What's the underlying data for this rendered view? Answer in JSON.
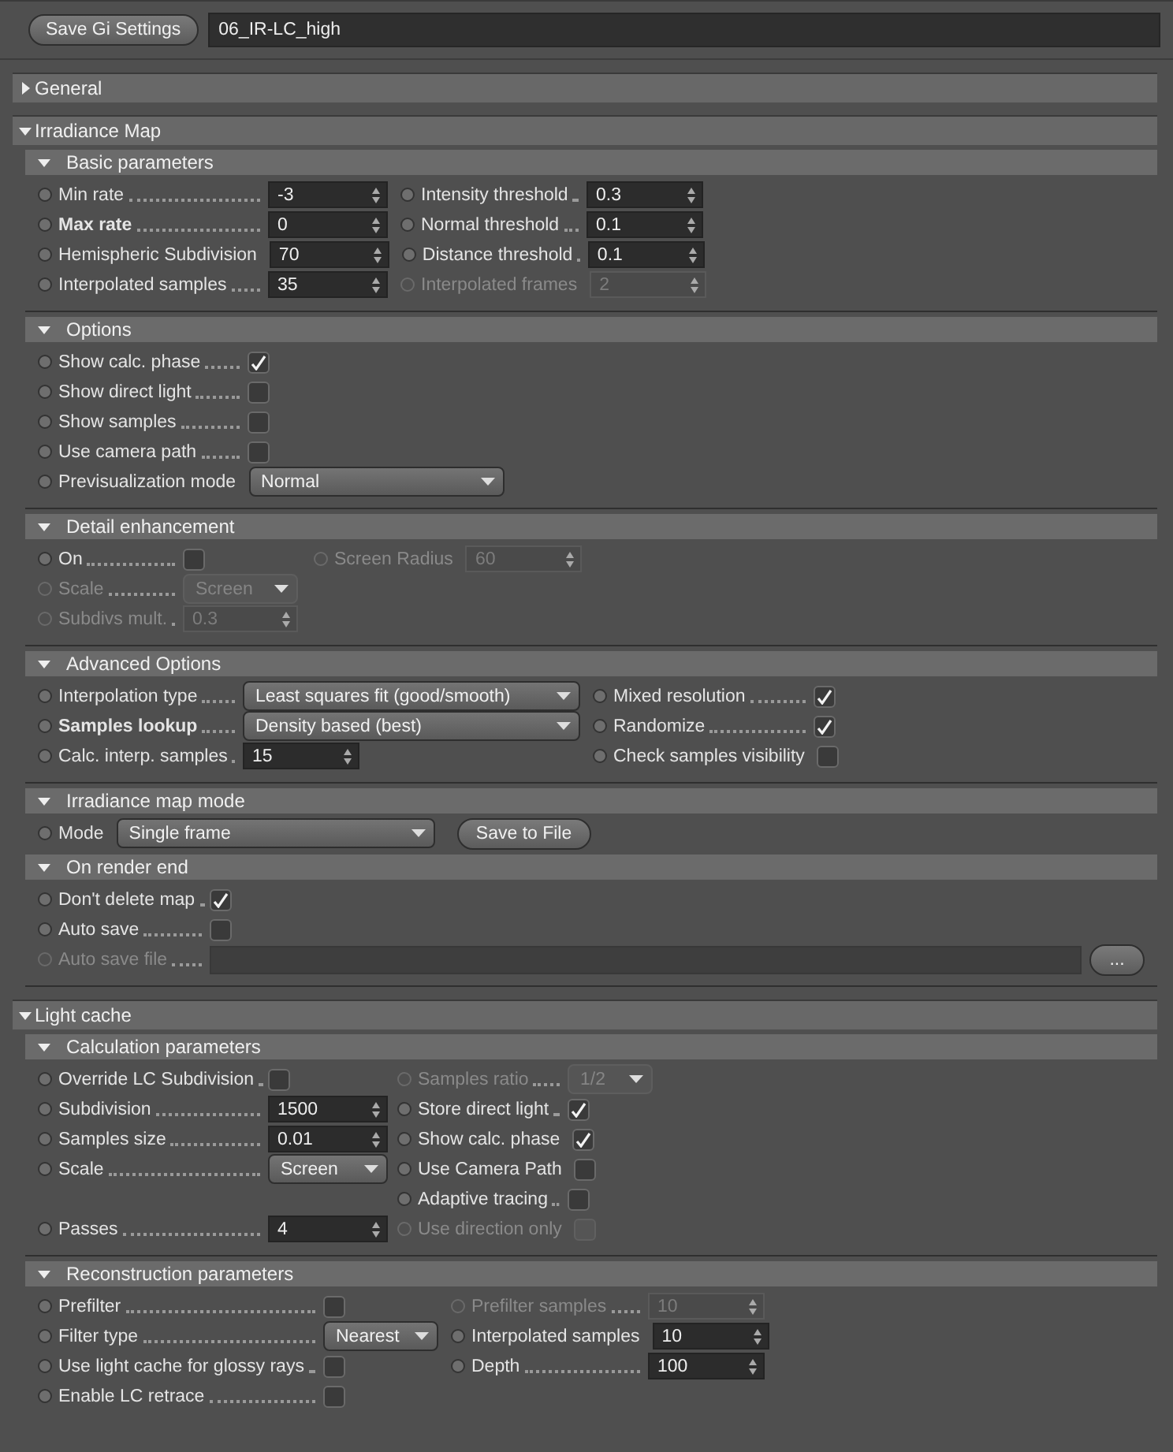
{
  "toolbar": {
    "button": "Save Gi Settings",
    "preset": "06_IR-LC_high"
  },
  "groups": [
    {
      "title": "General",
      "expanded": false
    },
    {
      "title": "Irradiance Map",
      "expanded": true,
      "sections": [
        {
          "title": "Basic parameters",
          "expanded": true,
          "rows": [
            [
              {
                "kind": "number",
                "label": "Min rate",
                "value": "-3",
                "disabled": false,
                "bold": false
              },
              {
                "kind": "number",
                "label": "Intensity threshold",
                "value": "0.3",
                "disabled": false,
                "bold": false
              }
            ],
            [
              {
                "kind": "number",
                "label": "Max rate",
                "value": "0",
                "disabled": false,
                "bold": true
              },
              {
                "kind": "number",
                "label": "Normal threshold",
                "value": "0.1",
                "disabled": false,
                "bold": false
              }
            ],
            [
              {
                "kind": "number",
                "label": "Hemispheric Subdivision",
                "value": "70",
                "disabled": false,
                "bold": false
              },
              {
                "kind": "number",
                "label": "Distance threshold",
                "value": "0.1",
                "disabled": false,
                "bold": false
              }
            ],
            [
              {
                "kind": "number",
                "label": "Interpolated samples",
                "value": "35",
                "disabled": false,
                "bold": false
              },
              {
                "kind": "number",
                "label": "Interpolated frames",
                "value": "2",
                "disabled": true,
                "bold": false
              }
            ]
          ]
        },
        {
          "title": "Options",
          "expanded": true,
          "rows": [
            [
              {
                "kind": "check",
                "label": "Show calc. phase",
                "checked": true,
                "disabled": false,
                "bold": false
              }
            ],
            [
              {
                "kind": "check",
                "label": "Show direct light",
                "checked": false,
                "disabled": false,
                "bold": false
              }
            ],
            [
              {
                "kind": "check",
                "label": "Show samples",
                "checked": false,
                "disabled": false,
                "bold": false
              }
            ],
            [
              {
                "kind": "check",
                "label": "Use camera path",
                "checked": false,
                "disabled": false,
                "bold": false
              }
            ],
            [
              {
                "kind": "select",
                "label": "Previsualization mode",
                "value": "Normal",
                "disabled": false,
                "bold": false
              }
            ]
          ]
        },
        {
          "title": "Detail enhancement",
          "expanded": true,
          "rows": [
            [
              {
                "kind": "check",
                "label": "On",
                "checked": false,
                "disabled": false,
                "bold": false
              },
              {
                "kind": "number",
                "label": "Screen Radius",
                "value": "60",
                "disabled": true,
                "bold": false
              }
            ],
            [
              {
                "kind": "select",
                "label": "Scale",
                "value": "Screen",
                "disabled": true,
                "bold": false
              }
            ],
            [
              {
                "kind": "number",
                "label": "Subdivs mult.",
                "value": "0.3",
                "disabled": true,
                "bold": false
              }
            ]
          ]
        },
        {
          "title": "Advanced Options",
          "expanded": true,
          "rows": [
            [
              {
                "kind": "select",
                "label": "Interpolation type",
                "value": "Least squares fit (good/smooth)",
                "disabled": false,
                "bold": false
              },
              {
                "kind": "check",
                "label": "Mixed resolution",
                "checked": true,
                "disabled": false,
                "bold": false
              }
            ],
            [
              {
                "kind": "select",
                "label": "Samples lookup",
                "value": "Density based (best)",
                "disabled": false,
                "bold": true
              },
              {
                "kind": "check",
                "label": "Randomize",
                "checked": true,
                "disabled": false,
                "bold": false
              }
            ],
            [
              {
                "kind": "number",
                "label": "Calc. interp. samples",
                "value": "15",
                "disabled": false,
                "bold": false
              },
              {
                "kind": "check",
                "label": "Check samples visibility",
                "checked": false,
                "disabled": false,
                "bold": false
              }
            ]
          ]
        },
        {
          "title": "Irradiance map mode",
          "expanded": true,
          "rows": [
            [
              {
                "kind": "select",
                "label": "Mode",
                "value": "Single frame",
                "disabled": false,
                "bold": false
              },
              {
                "kind": "button",
                "label": "Save to File",
                "disabled": false
              }
            ]
          ]
        },
        {
          "title": "On render end",
          "expanded": true,
          "rows": [
            [
              {
                "kind": "check",
                "label": "Don't delete map",
                "checked": true,
                "disabled": false,
                "bold": false
              }
            ],
            [
              {
                "kind": "check",
                "label": "Auto save",
                "checked": false,
                "disabled": false,
                "bold": false
              }
            ],
            [
              {
                "kind": "text",
                "label": "Auto save file",
                "disabled": true,
                "bold": false
              },
              {
                "kind": "button",
                "label": "...",
                "disabled": false
              }
            ]
          ]
        }
      ]
    },
    {
      "title": "Light cache",
      "expanded": true,
      "sections": [
        {
          "title": "Calculation parameters",
          "expanded": true,
          "rows": [
            [
              {
                "kind": "check",
                "label": "Override LC Subdivision",
                "checked": false,
                "disabled": false,
                "bold": false
              },
              {
                "kind": "select",
                "label": "Samples ratio",
                "value": "1/2",
                "disabled": true,
                "bold": false
              }
            ],
            [
              {
                "kind": "number",
                "label": "Subdivision",
                "value": "1500",
                "disabled": false,
                "bold": false
              },
              {
                "kind": "check",
                "label": "Store direct light",
                "checked": true,
                "disabled": false,
                "bold": false
              }
            ],
            [
              {
                "kind": "number",
                "label": "Samples size",
                "value": "0.01",
                "disabled": false,
                "bold": false
              },
              {
                "kind": "check",
                "label": "Show calc. phase",
                "checked": true,
                "disabled": false,
                "bold": false
              }
            ],
            [
              {
                "kind": "select",
                "label": "Scale",
                "value": "Screen",
                "disabled": false,
                "bold": false
              },
              {
                "kind": "check",
                "label": "Use Camera Path",
                "checked": false,
                "disabled": false,
                "bold": false
              }
            ],
            [
              {
                "kind": "blank"
              },
              {
                "kind": "check",
                "label": "Adaptive tracing",
                "checked": false,
                "disabled": false,
                "bold": false
              }
            ],
            [
              {
                "kind": "number",
                "label": "Passes",
                "value": "4",
                "disabled": false,
                "bold": false
              },
              {
                "kind": "check",
                "label": "Use direction only",
                "checked": false,
                "disabled": true,
                "bold": false
              }
            ]
          ]
        },
        {
          "title": "Reconstruction parameters",
          "expanded": true,
          "rows": [
            [
              {
                "kind": "check",
                "label": "Prefilter",
                "checked": false,
                "disabled": false,
                "bold": false
              },
              {
                "kind": "number",
                "label": "Prefilter samples",
                "value": "10",
                "disabled": true,
                "bold": false
              }
            ],
            [
              {
                "kind": "select",
                "label": "Filter type",
                "value": "Nearest",
                "disabled": false,
                "bold": false
              },
              {
                "kind": "number",
                "label": "Interpolated samples",
                "value": "10",
                "disabled": false,
                "bold": false
              }
            ],
            [
              {
                "kind": "check",
                "label": "Use light cache for glossy rays",
                "checked": false,
                "disabled": false,
                "bold": false
              },
              {
                "kind": "number",
                "label": "Depth",
                "value": "100",
                "disabled": false,
                "bold": false
              }
            ],
            [
              {
                "kind": "check",
                "label": "Enable LC retrace",
                "checked": false,
                "disabled": false,
                "bold": false
              }
            ]
          ]
        }
      ]
    }
  ]
}
